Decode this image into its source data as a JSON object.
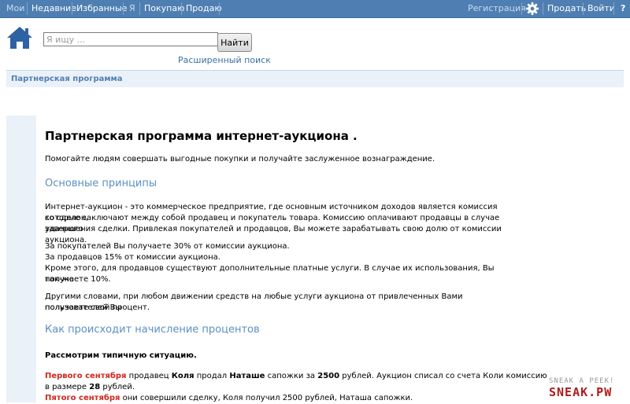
{
  "nav": {
    "moi": "Мои",
    "recent": "Недавние",
    "favorites": "Избранные",
    "me": "Я",
    "buying": "Покупаю",
    "selling": "Продаю",
    "register": "Регистрация",
    "settings_icon": "gear-icon",
    "sell": "Продать",
    "login": "Войти",
    "help": "?"
  },
  "header": {
    "home_icon": "home-icon",
    "search_placeholder": "Я ищу ...",
    "search_button": "Найти",
    "advanced_search": "Расширенный поиск"
  },
  "breadcrumb": "Партнерская программа",
  "content": {
    "title": "Партнерская программа интернет-аукциона .",
    "intro": "Помогайте людям совершать выгодные покупки и получайте заслуженное вознаграждение.",
    "h_principles": "Основные принципы",
    "p1_l1": "Интернет-аукцион - это коммерческое предприятие, где основным источником доходов является комиссия со сделок,",
    "p1_l2": "которые заключают между собой продавец и покупатель товара. Комиссию оплачивают продавцы в случае удачного",
    "p1_l3": "завершения сделки. Привлекая покупателей и продавцов, Вы можете зарабатывать свою долю от комиссии аукциона.",
    "p2_l1": "За покупателей Вы получаете 30% от комиссии аукциона.",
    "p2_l2": "За продавцов 15% от комиссии аукциона.",
    "p2_l3": "Кроме этого, для продавцов существуют дополнительные платные услуги. В случае их использования, Вы так-же",
    "p2_l4": "получаете 10%.",
    "p3_l1": "Другими словами, при любом движении средств на любые услуги аукциона от привлеченных Вами пользователей Вы",
    "p3_l2": "получаете свой процент.",
    "h_how": "Как происходит начисление процентов",
    "typical": "Рассмотрим типичную ситуацию.",
    "ex1_date": "Первого сентября",
    "ex1_a": " продавец ",
    "ex1_seller": "Коля",
    "ex1_b": " продал ",
    "ex1_buyer": "Наташе",
    "ex1_c": " сапожки за ",
    "ex1_price": "2500",
    "ex1_d": " рублей. Аукцион списал со счета Коли комиссию",
    "ex1_e": "в размере ",
    "ex1_fee": "28",
    "ex1_f": " рублей.",
    "ex2_date": "Пятого сентября",
    "ex2_rest": " они совершили сделку, Коля получил 2500 рублей, Наташа сапожки."
  },
  "watermark": {
    "line1": "SNEAK A PEEK!",
    "line2": "SNEAK.PW"
  }
}
